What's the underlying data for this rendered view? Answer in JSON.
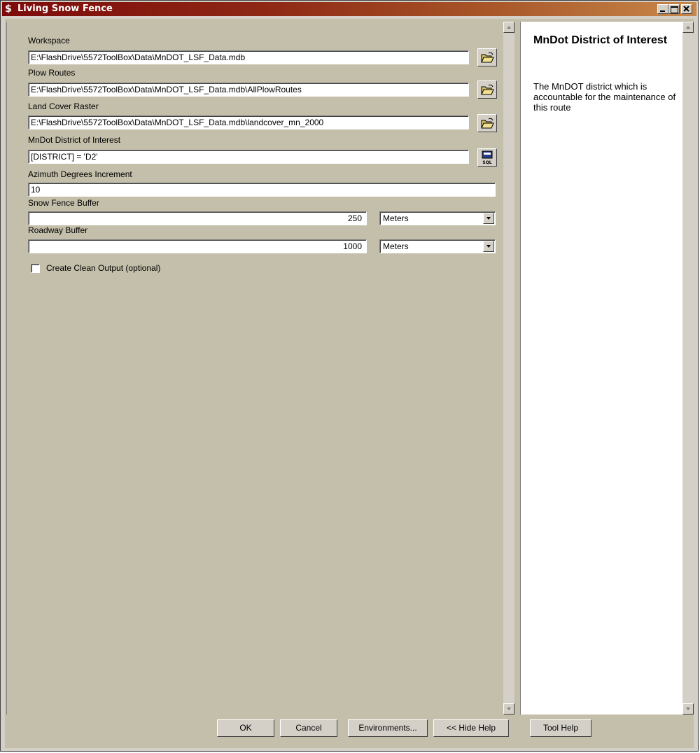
{
  "window": {
    "title": "Living Snow Fence",
    "app_icon": "dollar-sign-icon",
    "controls": [
      "minimize-icon",
      "maximize-icon",
      "close-icon"
    ]
  },
  "form": {
    "workspace": {
      "label": "Workspace",
      "value": "E:\\FlashDrive\\5572ToolBox\\Data\\MnDOT_LSF_Data.mdb",
      "button_icon": "open-folder-icon"
    },
    "plow_routes": {
      "label": "Plow Routes",
      "value": "E:\\FlashDrive\\5572ToolBox\\Data\\MnDOT_LSF_Data.mdb\\AllPlowRoutes",
      "button_icon": "open-folder-icon"
    },
    "land_cover": {
      "label": "Land Cover Raster",
      "value": "E:\\FlashDrive\\5572ToolBox\\Data\\MnDOT_LSF_Data.mdb\\landcover_mn_2000",
      "button_icon": "open-folder-icon"
    },
    "district": {
      "label": "MnDot District of Interest",
      "value": "[DISTRICT] = 'D2'",
      "button_icon": "sql-icon",
      "button_text": "SQL"
    },
    "azimuth": {
      "label": "Azimuth Degrees Increment",
      "value": "10"
    },
    "snow_fence_buffer": {
      "label": "Snow Fence Buffer",
      "value": "250",
      "unit": "Meters"
    },
    "roadway_buffer": {
      "label": "Roadway Buffer",
      "value": "1000",
      "unit": "Meters"
    },
    "clean_output": {
      "label": "Create Clean Output (optional)",
      "checked": false
    }
  },
  "help": {
    "title": "MnDot District of Interest",
    "body": "The MnDOT district which is accountable for the maintenance of this route"
  },
  "buttons": {
    "ok": "OK",
    "cancel": "Cancel",
    "environments": "Environments...",
    "hide_help": "<< Hide Help",
    "tool_help": "Tool Help"
  }
}
